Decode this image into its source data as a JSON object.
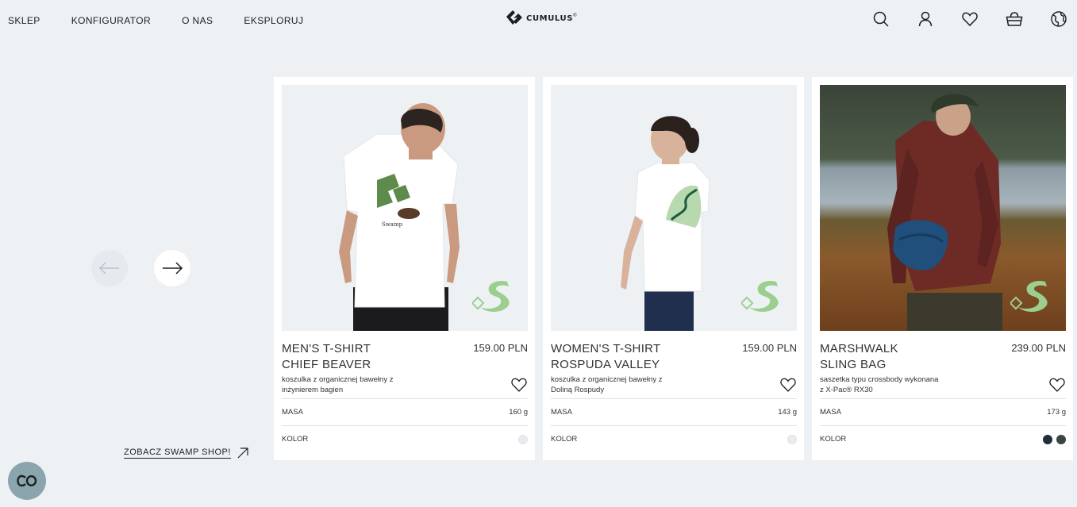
{
  "nav": [
    "SKLEP",
    "KONFIGURATOR",
    "O NAS",
    "EKSPLORUJ"
  ],
  "logo": {
    "text": "CUMULUS",
    "trademark": "®"
  },
  "header_icons": [
    "search-icon",
    "user-icon",
    "heart-icon",
    "basket-icon",
    "globe-icon"
  ],
  "carousel": {
    "prev": "arrow-left-icon",
    "next": "arrow-right-icon"
  },
  "swamp_link": {
    "label": "ZOBACZ SWAMP SHOP!"
  },
  "products": [
    {
      "name_line1": "MEN'S T-SHIRT",
      "name_line2": "CHIEF BEAVER",
      "price": "159.00 PLN",
      "desc_line1": "koszulka z organicznej bawełny z",
      "desc_line2": "inżynierem bagien",
      "mass_label": "MASA",
      "mass": "160 g",
      "color_label": "KOLOR",
      "colors": [
        "#e9ecee"
      ]
    },
    {
      "name_line1": "WOMEN'S T-SHIRT",
      "name_line2": "ROSPUDA VALLEY",
      "price": "159.00 PLN",
      "desc_line1": "koszulka z organicznej bawełny z",
      "desc_line2": "Doliną Rospudy",
      "mass_label": "MASA",
      "mass": "143 g",
      "color_label": "KOLOR",
      "colors": [
        "#e9ecee"
      ]
    },
    {
      "name_line1": "MARSHWALK",
      "name_line2": "SLING BAG",
      "price": "239.00 PLN",
      "desc_line1": "saszetka typu crossbody wykonana",
      "desc_line2": "z X-Pac® RX30",
      "mass_label": "MASA",
      "mass": "173 g",
      "color_label": "KOLOR",
      "colors": [
        "#1f2d3d",
        "#3c4446"
      ]
    }
  ],
  "fab": {
    "label": "CO"
  },
  "colors": {
    "background": "#eef1f4",
    "card": "#ffffff",
    "badge_green": "#9ccf8f",
    "fab": "#8aa5ad"
  }
}
